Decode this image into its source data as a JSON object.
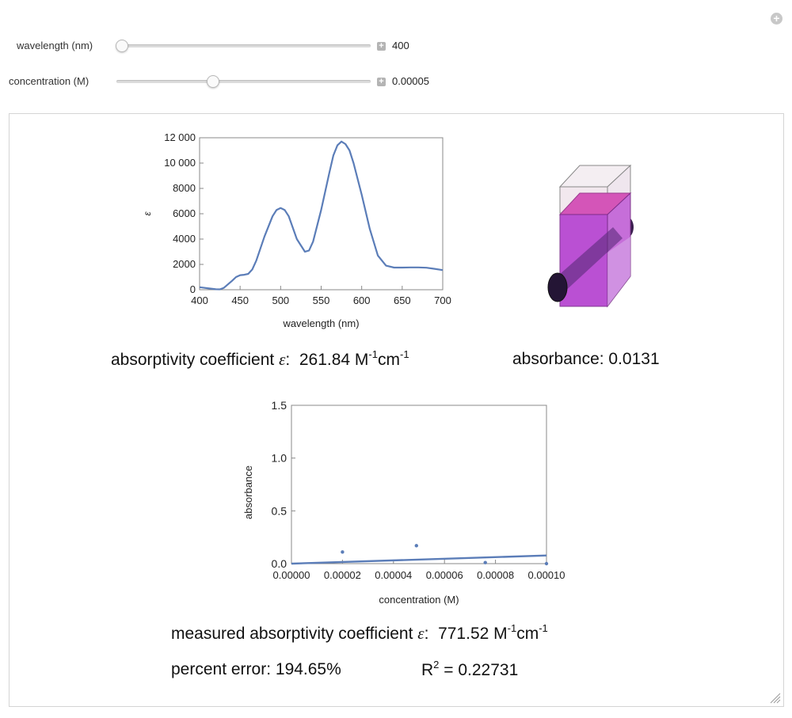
{
  "controls": {
    "wavelength": {
      "label": "wavelength (nm)",
      "value": "400",
      "position_fraction": 0.0
    },
    "concentration": {
      "label": "concentration (M)",
      "value": "0.00005",
      "position_fraction": 0.385
    }
  },
  "output": {
    "absorptivity_label": "absorptivity coefficient",
    "epsilon_symbol": "ε",
    "absorptivity_value": "261.84 M",
    "absorbance_text": "absorbance: 0.0131",
    "measured_label": "measured absorptivity coefficient",
    "measured_value": "771.52 M",
    "percent_error_text": "percent error: 194.65%",
    "r2_label": "R",
    "r2_value": " = 0.22731",
    "unit_cm": "cm",
    "exp_m1": "-1"
  },
  "chart_data": [
    {
      "type": "line",
      "xlabel": "wavelength (nm)",
      "ylabel": "ε",
      "xlim": [
        400,
        700
      ],
      "ylim": [
        0,
        12000
      ],
      "x_ticks": [
        400,
        450,
        500,
        550,
        600,
        650,
        700
      ],
      "y_ticks": [
        0,
        2000,
        4000,
        6000,
        8000,
        10000,
        12000
      ],
      "y_tick_labels": [
        "0",
        "2000",
        "4000",
        "6000",
        "8000",
        "10 000",
        "12 000"
      ],
      "x": [
        400,
        410,
        420,
        425,
        430,
        440,
        445,
        450,
        455,
        460,
        465,
        470,
        480,
        490,
        495,
        500,
        505,
        510,
        520,
        530,
        535,
        540,
        550,
        560,
        565,
        570,
        575,
        580,
        585,
        590,
        600,
        610,
        620,
        630,
        640,
        650,
        660,
        670,
        680,
        690,
        700
      ],
      "y": [
        200,
        120,
        40,
        30,
        150,
        700,
        1000,
        1150,
        1180,
        1250,
        1600,
        2300,
        4200,
        5800,
        6300,
        6450,
        6300,
        5800,
        4000,
        3000,
        3100,
        3800,
        6300,
        9200,
        10600,
        11400,
        11700,
        11500,
        11000,
        10000,
        7500,
        4800,
        2700,
        1900,
        1750,
        1750,
        1760,
        1760,
        1740,
        1650,
        1550
      ],
      "color": "#5b7db8"
    },
    {
      "type": "scatter",
      "xlabel": "concentration (M)",
      "ylabel": "absorbance",
      "xlim": [
        0,
        0.0001
      ],
      "ylim": [
        0,
        1.5
      ],
      "x_ticks": [
        0,
        2e-05,
        4e-05,
        6e-05,
        8e-05,
        0.0001
      ],
      "x_tick_labels": [
        "0.00000",
        "0.00002",
        "0.00004",
        "0.00006",
        "0.00008",
        "0.00010"
      ],
      "y_ticks": [
        0,
        0.5,
        1.0,
        1.5
      ],
      "y_tick_labels": [
        "0.0",
        "0.5",
        "1.0",
        "1.5"
      ],
      "points": [
        [
          2e-05,
          0.11
        ],
        [
          4.9e-05,
          0.17
        ],
        [
          7.6e-05,
          0.01
        ],
        [
          0.0001,
          0.0
        ]
      ],
      "fit_line": [
        [
          0,
          0.0
        ],
        [
          0.0001,
          0.077
        ]
      ],
      "color": "#5b7db8"
    }
  ],
  "colors": {
    "curve": "#5b7db8",
    "liquid": "#b030c8",
    "liquid_top": "#d040b0",
    "beam": "#2a1a3e"
  }
}
